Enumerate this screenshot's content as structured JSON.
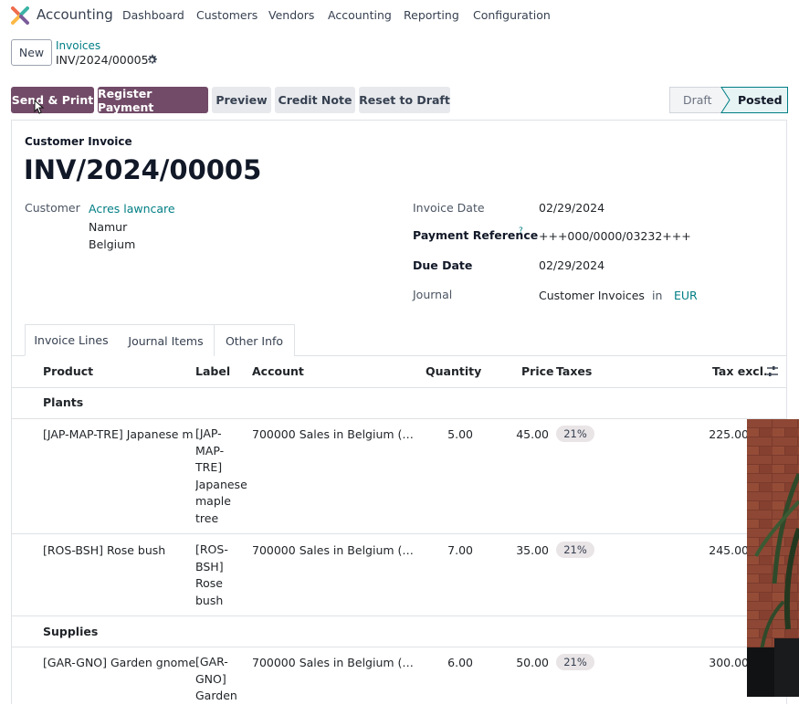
{
  "app": {
    "name": "Accounting"
  },
  "menu": [
    "Dashboard",
    "Customers",
    "Vendors",
    "Accounting",
    "Reporting",
    "Configuration"
  ],
  "control": {
    "new_label": "New",
    "breadcrumb_parent": "Invoices",
    "breadcrumb_current": "INV/2024/00005"
  },
  "actions": {
    "send_print": "Send & Print",
    "register_payment": "Register Payment",
    "preview": "Preview",
    "credit_note": "Credit Note",
    "reset_draft": "Reset to Draft"
  },
  "status": {
    "draft": "Draft",
    "posted": "Posted",
    "current": "Posted"
  },
  "form": {
    "doc_type": "Customer Invoice",
    "number": "INV/2024/00005",
    "customer_label": "Customer",
    "customer_name": "Acres lawncare",
    "customer_city": "Namur",
    "customer_country": "Belgium",
    "invoice_date_label": "Invoice Date",
    "invoice_date": "02/29/2024",
    "payment_ref_label": "Payment Reference",
    "payment_ref_help": "?",
    "payment_ref": "+++000/0000/03232+++",
    "due_date_label": "Due Date",
    "due_date": "02/29/2024",
    "journal_label": "Journal",
    "journal": "Customer Invoices",
    "journal_in": "in",
    "currency": "EUR"
  },
  "tabs": [
    "Invoice Lines",
    "Journal Items",
    "Other Info"
  ],
  "table": {
    "headers": {
      "product": "Product",
      "label": "Label",
      "account": "Account",
      "quantity": "Quantity",
      "price": "Price",
      "taxes": "Taxes",
      "tax_excl": "Tax excl."
    },
    "sections": [
      "Plants",
      "Supplies"
    ],
    "rows": [
      {
        "product": "[JAP-MAP-TRE] Japanese maple tree",
        "label_lines": [
          "[JAP-",
          "MAP-",
          "TRE]",
          "Japanese",
          "maple",
          "tree"
        ],
        "account": "700000 Sales in Belgium (…",
        "quantity": "5.00",
        "price": "45.00",
        "tax": "21%",
        "subtotal": "225.00"
      },
      {
        "product": "[ROS-BSH] Rose bush",
        "label_lines": [
          "[ROS-",
          "BSH]",
          "Rose",
          "bush"
        ],
        "account": "700000 Sales in Belgium (…",
        "quantity": "7.00",
        "price": "35.00",
        "tax": "21%",
        "subtotal": "245.00"
      },
      {
        "product": "[GAR-GNO] Garden gnome",
        "label_lines": [
          "[GAR-",
          "GNO]",
          "Garden"
        ],
        "account": "700000 Sales in Belgium (…",
        "quantity": "6.00",
        "price": "50.00",
        "tax": "21%",
        "subtotal": "300.00"
      }
    ]
  },
  "colors": {
    "primary": "#714b67",
    "link": "#017e84",
    "secondary_btn": "#e7e9ed"
  },
  "icons": [
    "odoo-logo-icon",
    "gear-icon",
    "optional-columns-icon"
  ]
}
